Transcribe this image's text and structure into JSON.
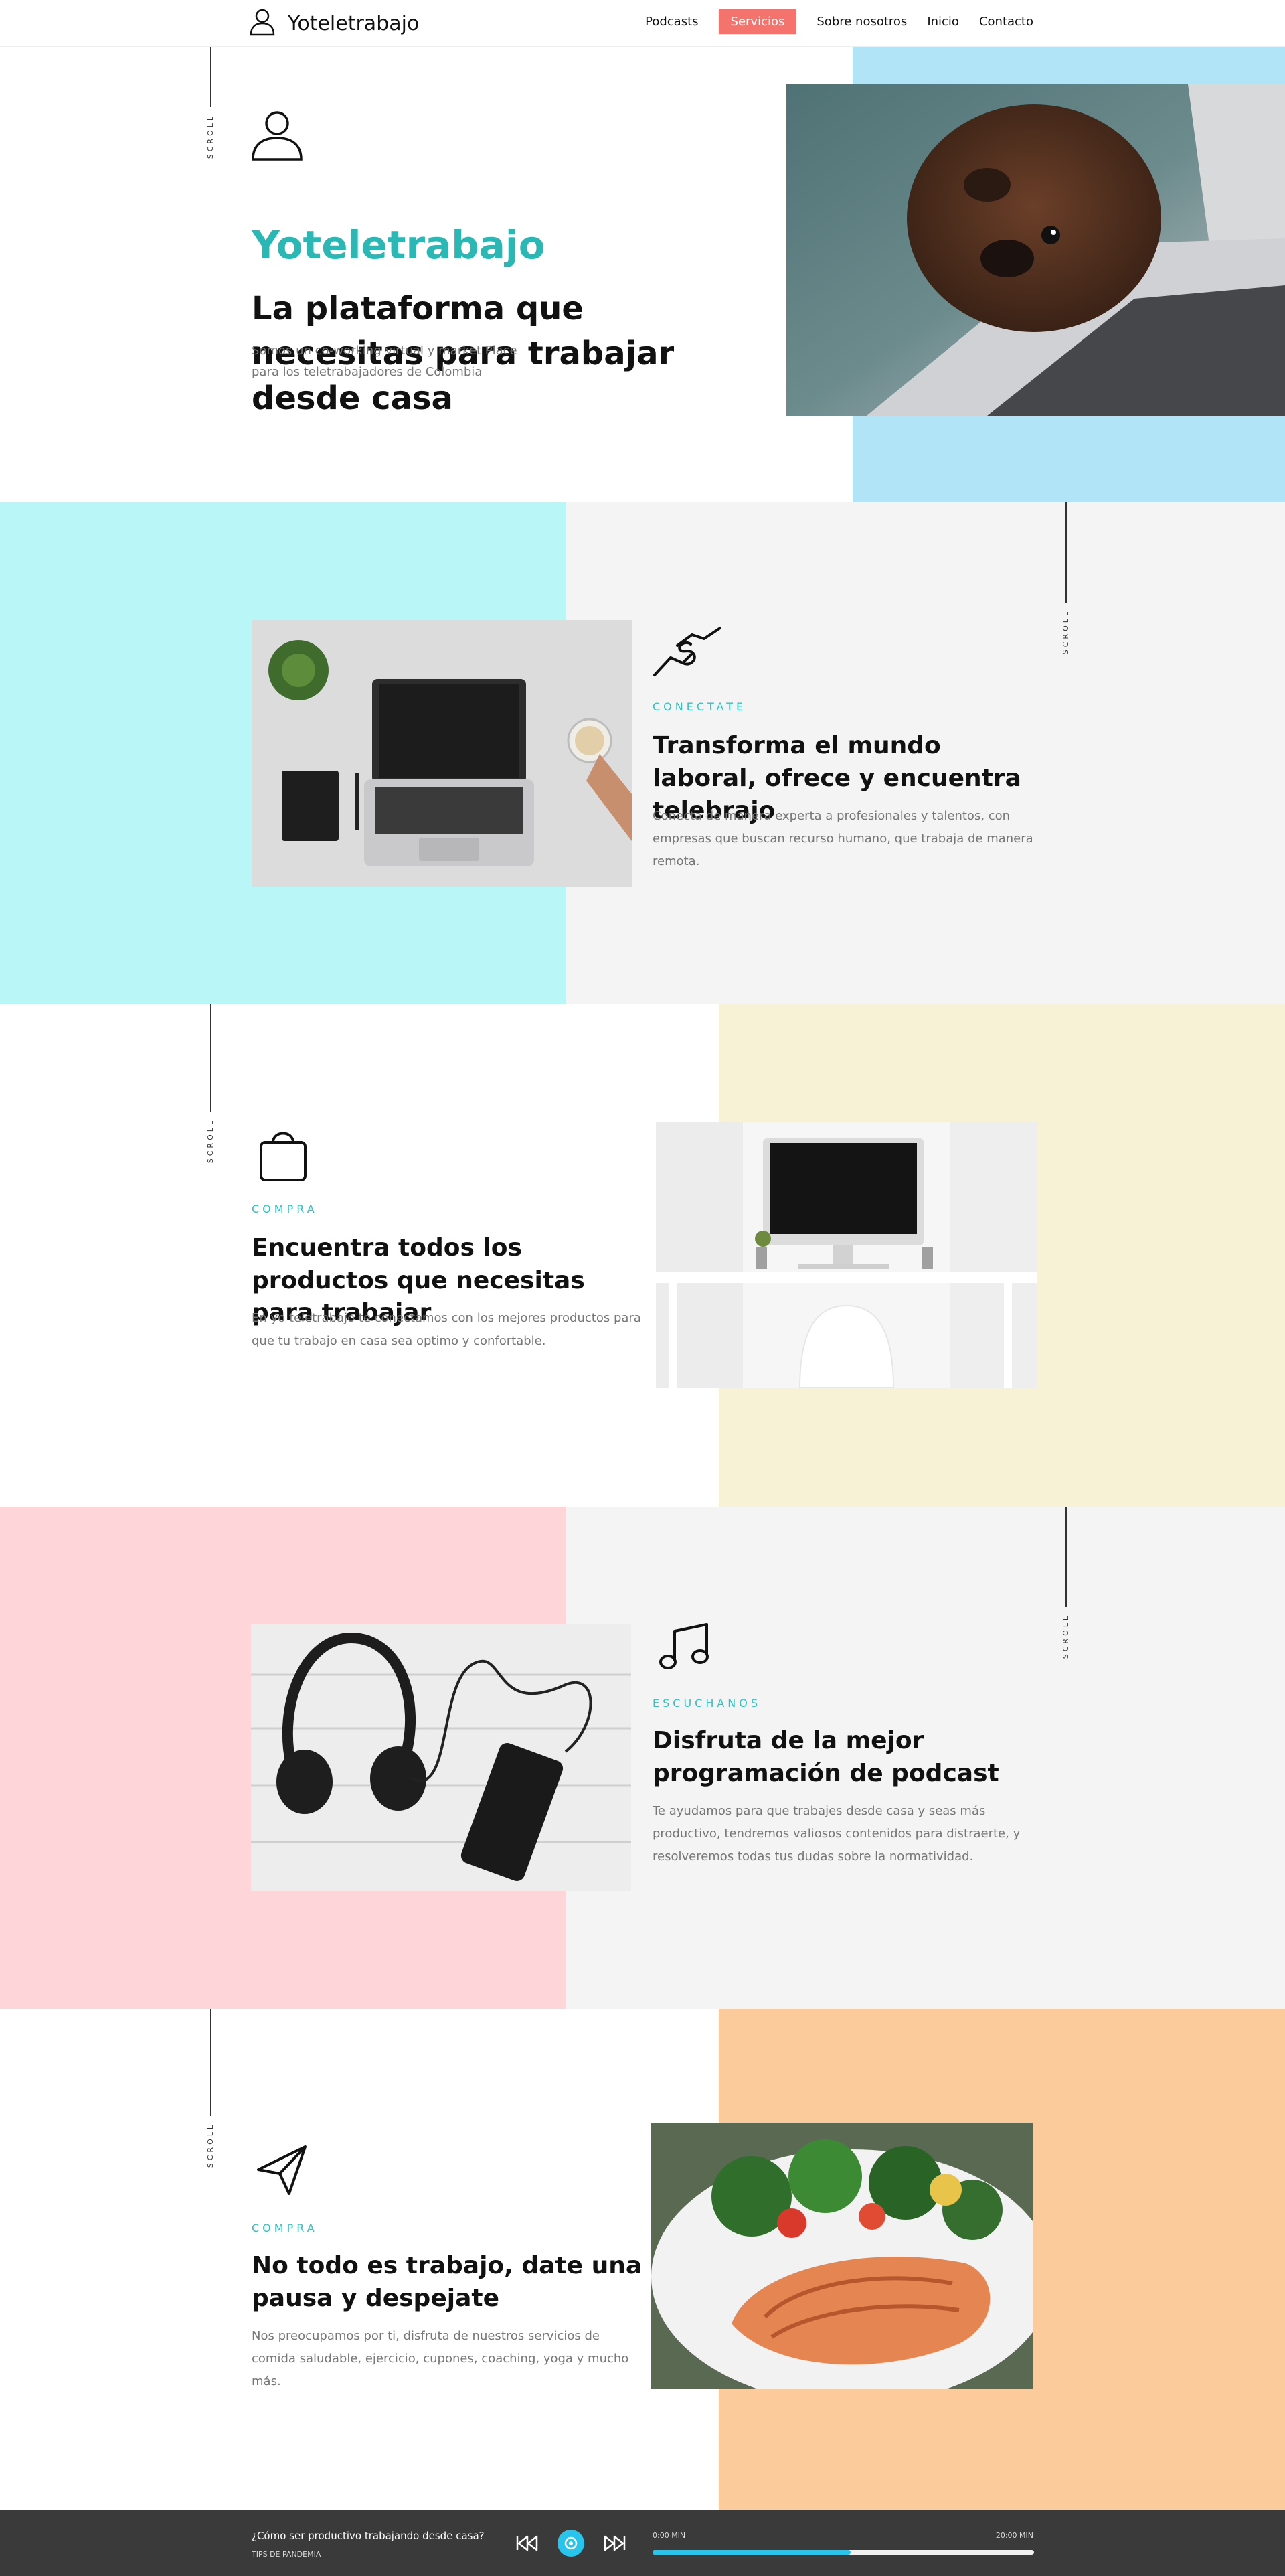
{
  "nav": {
    "brand": "Yoteletrabajo",
    "links": [
      "Podcasts",
      "Servicios",
      "Sobre nosotros",
      "Inicio",
      "Contacto"
    ],
    "active_index": 1
  },
  "scroll_label": "SCROLL",
  "hero": {
    "title": "Yoteletrabajo",
    "heading": "La plataforma que necesitas para trabajar desde casa",
    "desc_line1": "Somos un co-working virtual y market Place",
    "desc_line2": "para los teletrabajadores de Colombia"
  },
  "sections": [
    {
      "eyebrow": "CONECTATE",
      "heading": "Transforma el mundo laboral, ofrece y encuentra telebrajo",
      "desc": "Conecta de manera experta a profesionales y talentos, con empresas que buscan recurso humano, que trabaja de manera remota."
    },
    {
      "eyebrow": "COMPRA",
      "heading": "Encuentra todos los productos que necesitas para trabajar",
      "desc": "En yo teletrabajo te conectamos con los mejores productos para que tu trabajo en casa sea optimo y confortable."
    },
    {
      "eyebrow": "ESCUCHANOS",
      "heading": "Disfruta de la mejor programación de podcast",
      "desc": "Te ayudamos para que trabajes desde casa y seas más productivo, tendremos valiosos contenidos para distraerte, y resolveremos todas tus dudas sobre la normatividad."
    },
    {
      "eyebrow": "COMPRA",
      "heading": "No todo es trabajo, date una pausa y despejate",
      "desc": "Nos preocupamos por ti, disfruta de nuestros servicios de comida saludable, ejercicio, cupones, coaching, yoga y mucho más."
    }
  ],
  "player": {
    "question": "¿Cómo ser productivo trabajando desde casa?",
    "tag": "TIPS DE PANDEMIA",
    "time_start": "0:00 MIN",
    "time_end": "20:00 MIN",
    "progress": 0.52
  },
  "colors": {
    "accent_teal": "#2bb8b4",
    "nav_active": "#f4736d",
    "hero_band": "#b1e4f6",
    "cyan_band": "#b9f6f7",
    "yellow_band": "#f7f1d6",
    "pink_band": "#fed6d9",
    "orange_band": "#fccb9b",
    "gray_bg": "#f4f4f4",
    "player_bg": "#3a3a3a",
    "player_progress": "#29c3ec"
  },
  "icons": [
    "user-icon",
    "handshake-icon",
    "shopping-bag-icon",
    "music-note-icon",
    "paper-plane-icon",
    "skip-back-icon",
    "play-icon",
    "skip-forward-icon"
  ]
}
